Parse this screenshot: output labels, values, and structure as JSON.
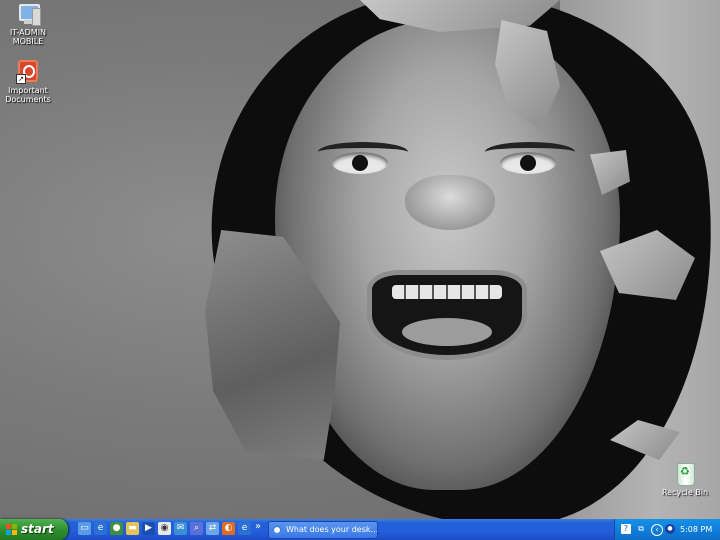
{
  "desktop": {
    "icons": [
      {
        "label": "IT-ADMIN\nMOBILE",
        "icon": "my-computer-icon"
      },
      {
        "label": "Important\nDocuments",
        "icon": "pdf-shortcut-icon"
      },
      {
        "label": "Recycle Bin",
        "icon": "recycle-bin-icon"
      }
    ]
  },
  "taskbar": {
    "start_label": "start",
    "quicklaunch_icons": [
      "show-desktop-icon",
      "internet-explorer-icon",
      "messenger-icon",
      "folder-icon",
      "windows-media-player-icon",
      "media-icon",
      "outlook-icon",
      "search-icon",
      "network-icon",
      "firefox-icon",
      "ie-icon"
    ],
    "overflow_label": "»",
    "task_item_label": "What does your desk...",
    "tray": {
      "icons": [
        "help-icon",
        "network-status-icon",
        "volume-icon",
        "antivirus-icon"
      ],
      "clock": "5:08 PM"
    }
  },
  "colors": {
    "taskbar_blue": "#245edb",
    "start_green": "#2c8b2c",
    "tray_blue": "#0f7bd8"
  }
}
